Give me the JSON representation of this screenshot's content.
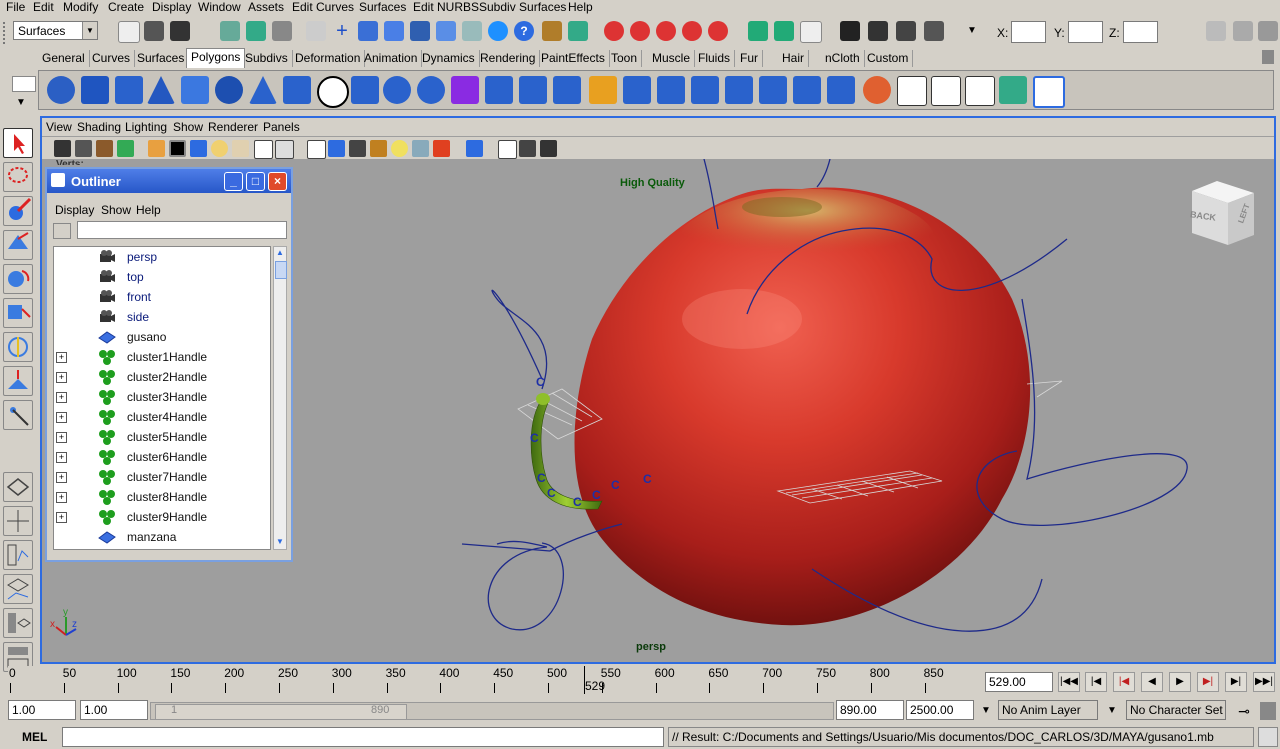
{
  "menubar": [
    "File",
    "Edit",
    "Modify",
    "Create",
    "Display",
    "Window",
    "Assets",
    "Edit Curves",
    "Surfaces",
    "Edit NURBS",
    "Subdiv Surfaces",
    "Help"
  ],
  "mode_select": "Surfaces",
  "coords": {
    "x_label": "X:",
    "y_label": "Y:",
    "z_label": "Z:"
  },
  "shelf_tabs": [
    "General",
    "Curves",
    "Surfaces",
    "Polygons",
    "Subdivs",
    "Deformation",
    "Animation",
    "Dynamics",
    "Rendering",
    "PaintEffects",
    "Toon",
    "Muscle",
    "Fluids",
    "Fur",
    "Hair",
    "nCloth",
    "Custom"
  ],
  "active_shelf_tab": "Polygons",
  "viewport": {
    "menu": [
      "View",
      "Shading",
      "Lighting",
      "Show",
      "Renderer",
      "Panels"
    ],
    "hud_quality": "High Quality",
    "camera_label": "persp",
    "viewcube": {
      "back": "BACK",
      "left": "LEFT"
    },
    "axis": {
      "x": "x",
      "y": "y",
      "z": "z"
    },
    "hud_vertex": "Verts:"
  },
  "outliner": {
    "title": "Outliner",
    "menu": [
      "Display",
      "Show",
      "Help"
    ],
    "items": [
      {
        "name": "persp",
        "type": "camera",
        "expand": false
      },
      {
        "name": "top",
        "type": "camera",
        "expand": false
      },
      {
        "name": "front",
        "type": "camera",
        "expand": false
      },
      {
        "name": "side",
        "type": "camera",
        "expand": false
      },
      {
        "name": "gusano",
        "type": "mesh",
        "expand": false
      },
      {
        "name": "cluster1Handle",
        "type": "cluster",
        "expand": true
      },
      {
        "name": "cluster2Handle",
        "type": "cluster",
        "expand": true
      },
      {
        "name": "cluster3Handle",
        "type": "cluster",
        "expand": true
      },
      {
        "name": "cluster4Handle",
        "type": "cluster",
        "expand": true
      },
      {
        "name": "cluster5Handle",
        "type": "cluster",
        "expand": true
      },
      {
        "name": "cluster6Handle",
        "type": "cluster",
        "expand": true
      },
      {
        "name": "cluster7Handle",
        "type": "cluster",
        "expand": true
      },
      {
        "name": "cluster8Handle",
        "type": "cluster",
        "expand": true
      },
      {
        "name": "cluster9Handle",
        "type": "cluster",
        "expand": true
      },
      {
        "name": "manzana",
        "type": "mesh",
        "expand": false
      }
    ]
  },
  "timeline": {
    "ticks": [
      "0",
      "50",
      "100",
      "150",
      "200",
      "250",
      "300",
      "350",
      "400",
      "450",
      "500",
      "550",
      "600",
      "650",
      "700",
      "750",
      "800",
      "850"
    ],
    "current_frame_marker": "529",
    "current_frame": "529.00"
  },
  "range": {
    "start": "1.00",
    "playback_start": "1.00",
    "slider_start": "1",
    "slider_end": "890",
    "playback_end": "890.00",
    "end": "2500.00",
    "anim_layer": "No Anim Layer",
    "character_set": "No Character Set"
  },
  "command": {
    "label": "MEL",
    "result": "// Result: C:/Documents and Settings/Usuario/Mis documentos/DOC_CARLOS/3D/MAYA/gusano1.mb"
  }
}
